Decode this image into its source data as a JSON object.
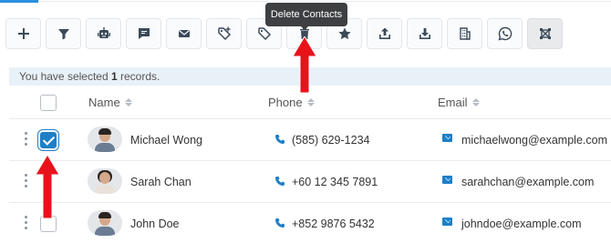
{
  "toolbar": {
    "buttons": [
      {
        "name": "add-button",
        "icon": "plus-icon"
      },
      {
        "name": "filter-button",
        "icon": "filter-icon"
      },
      {
        "name": "bot-button",
        "icon": "robot-icon"
      },
      {
        "name": "sms-button",
        "icon": "chat-icon"
      },
      {
        "name": "email-button",
        "icon": "envelope-icon"
      },
      {
        "name": "add-tag-button",
        "icon": "tag-plus-icon"
      },
      {
        "name": "remove-tag-button",
        "icon": "tag-icon"
      },
      {
        "name": "delete-contacts-button",
        "icon": "trash-icon"
      },
      {
        "name": "star-button",
        "icon": "star-icon"
      },
      {
        "name": "export-button",
        "icon": "upload-icon"
      },
      {
        "name": "import-button",
        "icon": "download-icon"
      },
      {
        "name": "company-button",
        "icon": "building-icon"
      },
      {
        "name": "whatsapp-button",
        "icon": "whatsapp-icon"
      },
      {
        "name": "merge-button",
        "icon": "merge-icon"
      }
    ],
    "tooltip": "Delete Contacts"
  },
  "selection": {
    "prefix": "You have selected",
    "count": "1",
    "suffix": "records."
  },
  "table": {
    "columns": [
      "Name",
      "Phone",
      "Email"
    ],
    "rows": [
      {
        "name": "Michael Wong",
        "phone": "(585) 629-1234",
        "email": "michaelwong@example.com",
        "checked": true,
        "avatar": "male"
      },
      {
        "name": "Sarah Chan",
        "phone": "+60 12 345 7891",
        "email": "sarahchan@example.com",
        "checked": false,
        "avatar": "female"
      },
      {
        "name": "John Doe",
        "phone": "+852 9876 5432",
        "email": "johndoe@example.com",
        "checked": false,
        "avatar": "male"
      }
    ]
  },
  "colors": {
    "accent": "#1f7fc6",
    "arrow": "#e8121b",
    "tooltip_bg": "#3d3f42",
    "selected_bar": "#e9f1f8"
  }
}
